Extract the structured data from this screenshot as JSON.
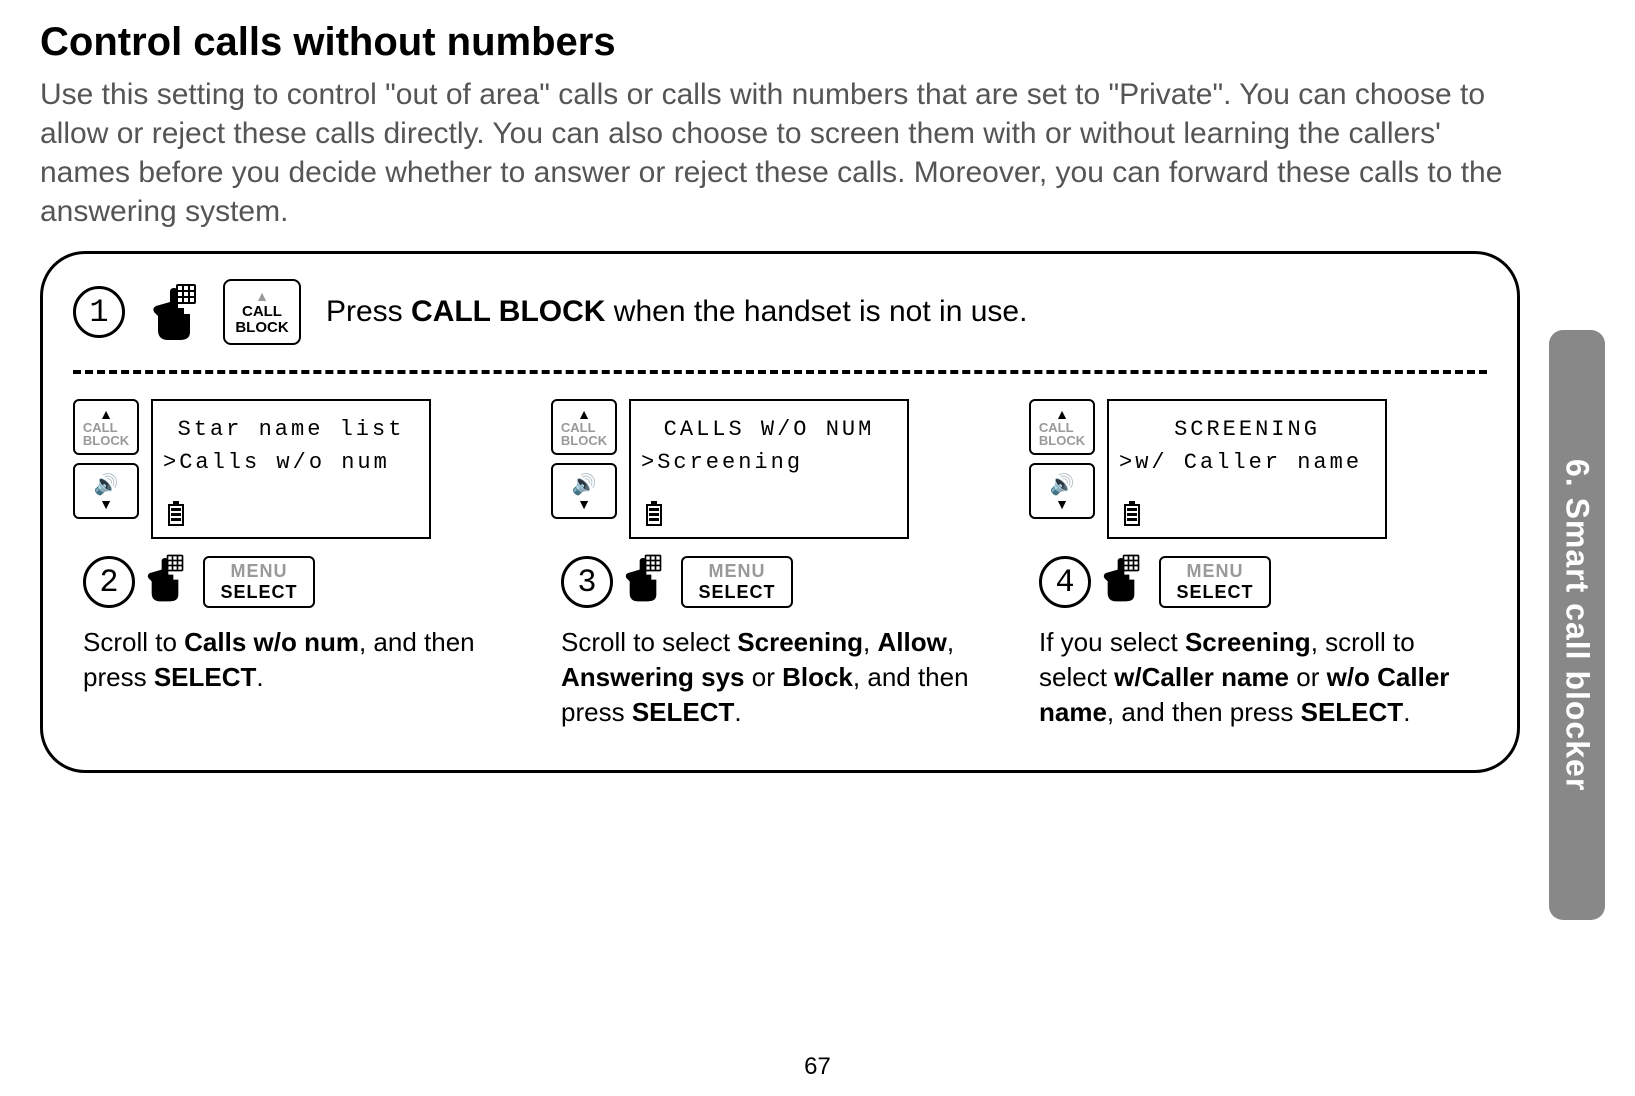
{
  "title": "Control calls without numbers",
  "intro": "Use this setting to control \"out of area\" calls or calls with numbers that are set to \"Private\". You can choose to allow or reject these calls directly. You can also choose to screen them with or without learning the callers' names before you decide whether to answer or reject these calls. Moreover, you can forward these calls to the answering system.",
  "step1": {
    "number": "1",
    "text_prefix": "Press ",
    "text_bold": "CALL BLOCK",
    "text_suffix": " when the handset is not in use."
  },
  "steps": [
    {
      "number": "2",
      "lcd_line1": "Star name list",
      "lcd_line2": ">Calls w/o num",
      "text_parts": [
        "Scroll to ",
        "Calls w/o num",
        ", and then press ",
        "SELECT",
        "."
      ]
    },
    {
      "number": "3",
      "lcd_line1": "CALLS W/O NUM",
      "lcd_line2": ">Screening",
      "text_parts": [
        "Scroll to select ",
        "Screening",
        ", ",
        "Allow",
        ", ",
        "Answering sys",
        " or ",
        "Block",
        ", and then press ",
        "SELECT",
        "."
      ]
    },
    {
      "number": "4",
      "lcd_line1": "SCREENING",
      "lcd_line2": ">w/ Caller name",
      "text_parts": [
        "If you select ",
        "Screening",
        ", scroll to select ",
        "w/Caller name",
        " or ",
        "w/o Caller name",
        ", and then press ",
        "SELECT",
        "."
      ]
    }
  ],
  "buttons": {
    "call_block": "CALL\nBLOCK",
    "menu": "MENU",
    "select": "SELECT",
    "nav_call_block": "CALL\nBLOCK"
  },
  "sidebar": "6. Smart call blocker",
  "page_number": "67"
}
